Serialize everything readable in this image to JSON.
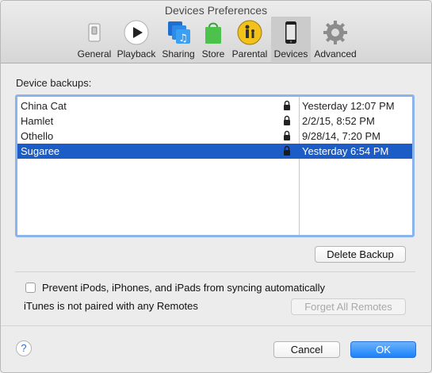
{
  "window": {
    "title": "Devices Preferences"
  },
  "toolbar": {
    "tabs": [
      {
        "label": "General",
        "icon": "general-switch-icon"
      },
      {
        "label": "Playback",
        "icon": "play-icon"
      },
      {
        "label": "Sharing",
        "icon": "sharing-music-icon"
      },
      {
        "label": "Store",
        "icon": "store-bag-icon"
      },
      {
        "label": "Parental",
        "icon": "parental-icon"
      },
      {
        "label": "Devices",
        "icon": "device-phone-icon",
        "selected": true
      },
      {
        "label": "Advanced",
        "icon": "gear-icon"
      }
    ]
  },
  "backups": {
    "label": "Device backups:",
    "rows": [
      {
        "name": "China Cat",
        "date": "Yesterday 12:07 PM",
        "locked": true,
        "selected": false
      },
      {
        "name": "Hamlet",
        "date": "2/2/15, 8:52 PM",
        "locked": true,
        "selected": false
      },
      {
        "name": "Othello",
        "date": "9/28/14, 7:20 PM",
        "locked": true,
        "selected": false
      },
      {
        "name": "Sugaree",
        "date": "Yesterday 6:54 PM",
        "locked": true,
        "selected": true
      }
    ],
    "delete_button": "Delete Backup"
  },
  "sync": {
    "prevent_label": "Prevent iPods, iPhones, and iPads from syncing automatically",
    "prevent_checked": false,
    "remotes_text": "iTunes is not paired with any Remotes",
    "forget_button": "Forget All Remotes"
  },
  "footer": {
    "help": "?",
    "cancel": "Cancel",
    "ok": "OK"
  },
  "colors": {
    "selection": "#1c5cc7",
    "list_focus": "#8bb4ec",
    "primary_button": "#1a82fb"
  }
}
